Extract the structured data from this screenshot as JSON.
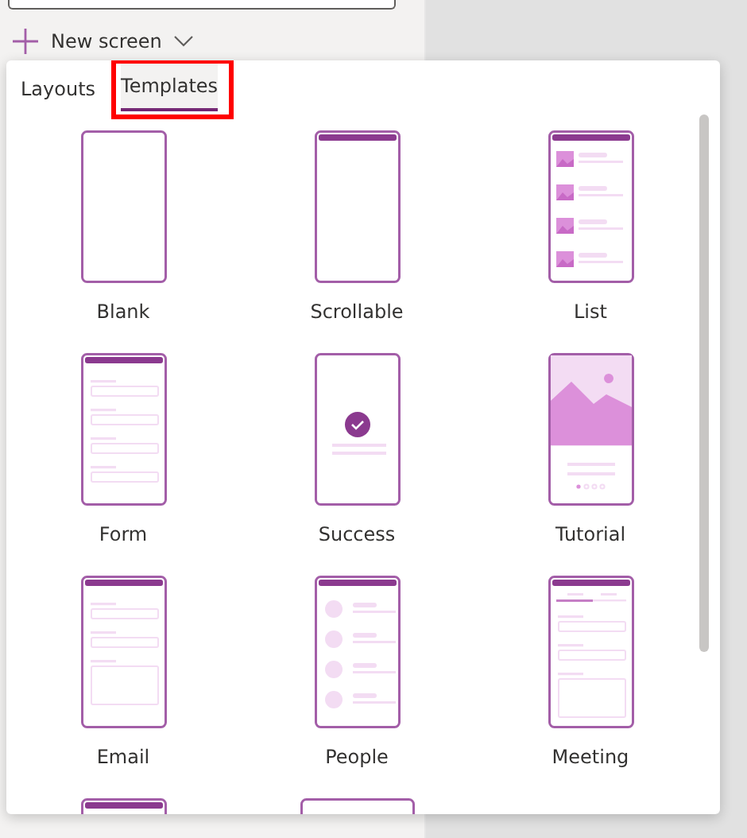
{
  "new_screen": {
    "label": "New screen"
  },
  "tabs": [
    {
      "label": "Layouts",
      "selected": false,
      "highlighted": false
    },
    {
      "label": "Templates",
      "selected": true,
      "highlighted": true
    }
  ],
  "templates": [
    {
      "label": "Blank",
      "kind": "blank"
    },
    {
      "label": "Scrollable",
      "kind": "scrollable"
    },
    {
      "label": "List",
      "kind": "list"
    },
    {
      "label": "Form",
      "kind": "form"
    },
    {
      "label": "Success",
      "kind": "success"
    },
    {
      "label": "Tutorial",
      "kind": "tutorial"
    },
    {
      "label": "Email",
      "kind": "email"
    },
    {
      "label": "People",
      "kind": "people"
    },
    {
      "label": "Meeting",
      "kind": "meeting"
    },
    {
      "kind": "header"
    },
    {
      "kind": "wide"
    }
  ]
}
